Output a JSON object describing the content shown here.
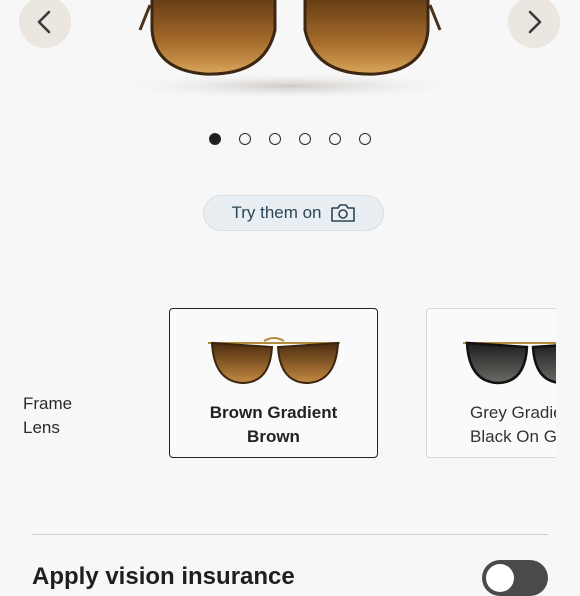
{
  "gallery": {
    "prev_icon": "chevron-left-icon",
    "next_icon": "chevron-right-icon",
    "slide_count": 6,
    "active_slide": 1
  },
  "try_on": {
    "label": "Try them on",
    "icon": "camera-icon"
  },
  "selector": {
    "frame_label": "Frame",
    "lens_label": "Lens",
    "variants": [
      {
        "line1": "Brown Gradient",
        "line2": "Brown",
        "selected": true,
        "lens_color": "#8a5a22",
        "frame_color": "#5a3a1c"
      },
      {
        "line1": "Grey Gradient",
        "line2": "Black On Gold",
        "selected": false,
        "lens_color": "#3a3a38",
        "frame_color": "#111111"
      }
    ]
  },
  "vision_insurance": {
    "label": "Apply vision insurance",
    "enabled": false
  }
}
